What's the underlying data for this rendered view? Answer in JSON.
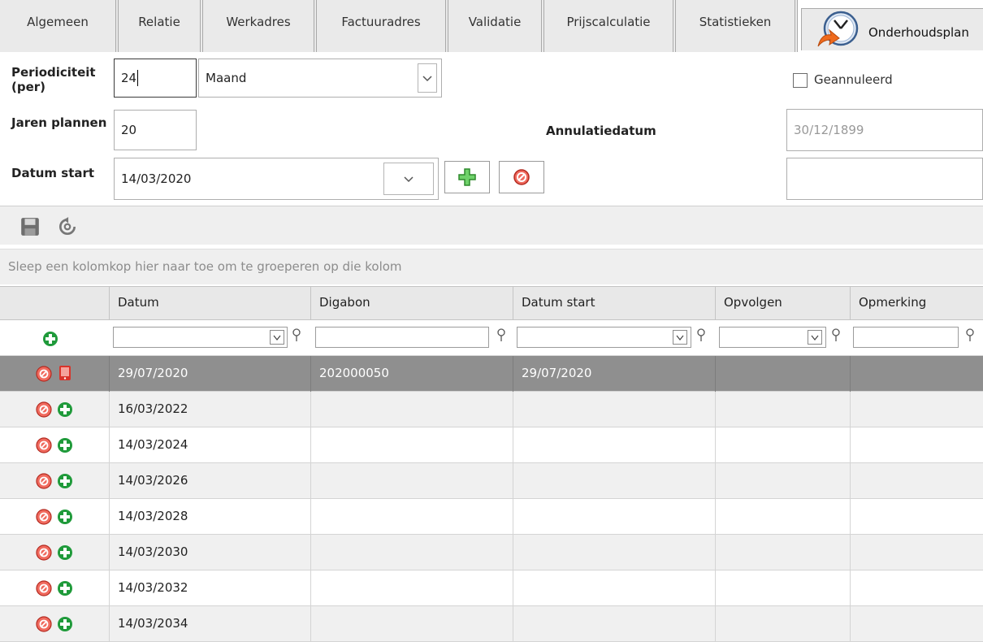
{
  "tabs": [
    {
      "label": "Algemeen"
    },
    {
      "label": "Relatie"
    },
    {
      "label": "Werkadres"
    },
    {
      "label": "Factuuradres"
    },
    {
      "label": "Validatie"
    },
    {
      "label": "Prijscalculatie"
    },
    {
      "label": "Statistieken"
    },
    {
      "label": "Onderhoudsplan"
    }
  ],
  "form": {
    "periodiciteit_label": "Periodiciteit (per)",
    "periodiciteit_value": "24",
    "periodiciteit_unit": "Maand",
    "jaren_label": "Jaren plannen",
    "jaren_value": "20",
    "datum_start_label": "Datum start",
    "datum_start_value": "14/03/2020",
    "geannuleerd_label": "Geannuleerd",
    "geannuleerd_checked": false,
    "annulatiedatum_label": "Annulatiedatum",
    "annulatiedatum_value": "30/12/1899",
    "extra_field_value": ""
  },
  "grid": {
    "group_hint": "Sleep een kolomkop hier naar toe om te groeperen op die kolom",
    "columns": [
      "Datum",
      "Digabon",
      "Datum start",
      "Opvolgen",
      "Opmerking"
    ],
    "rows": [
      {
        "datum": "29/07/2020",
        "digabon": "202000050",
        "datum_start": "29/07/2020",
        "opvolgen": "",
        "opmerking": "",
        "selected": true,
        "icon": "device-icon"
      },
      {
        "datum": "16/03/2022",
        "digabon": "",
        "datum_start": "",
        "opvolgen": "",
        "opmerking": "",
        "selected": false,
        "icon": "add-icon"
      },
      {
        "datum": "14/03/2024",
        "digabon": "",
        "datum_start": "",
        "opvolgen": "",
        "opmerking": "",
        "selected": false,
        "icon": "add-icon"
      },
      {
        "datum": "14/03/2026",
        "digabon": "",
        "datum_start": "",
        "opvolgen": "",
        "opmerking": "",
        "selected": false,
        "icon": "add-icon"
      },
      {
        "datum": "14/03/2028",
        "digabon": "",
        "datum_start": "",
        "opvolgen": "",
        "opmerking": "",
        "selected": false,
        "icon": "add-icon"
      },
      {
        "datum": "14/03/2030",
        "digabon": "",
        "datum_start": "",
        "opvolgen": "",
        "opmerking": "",
        "selected": false,
        "icon": "add-icon"
      },
      {
        "datum": "14/03/2032",
        "digabon": "",
        "datum_start": "",
        "opvolgen": "",
        "opmerking": "",
        "selected": false,
        "icon": "add-icon"
      },
      {
        "datum": "14/03/2034",
        "digabon": "",
        "datum_start": "",
        "opvolgen": "",
        "opmerking": "",
        "selected": false,
        "icon": "add-icon"
      }
    ]
  },
  "colors": {
    "selected_row": "#8f8f8f",
    "delete_red": "#d9342b",
    "add_green": "#1f9a3a"
  }
}
